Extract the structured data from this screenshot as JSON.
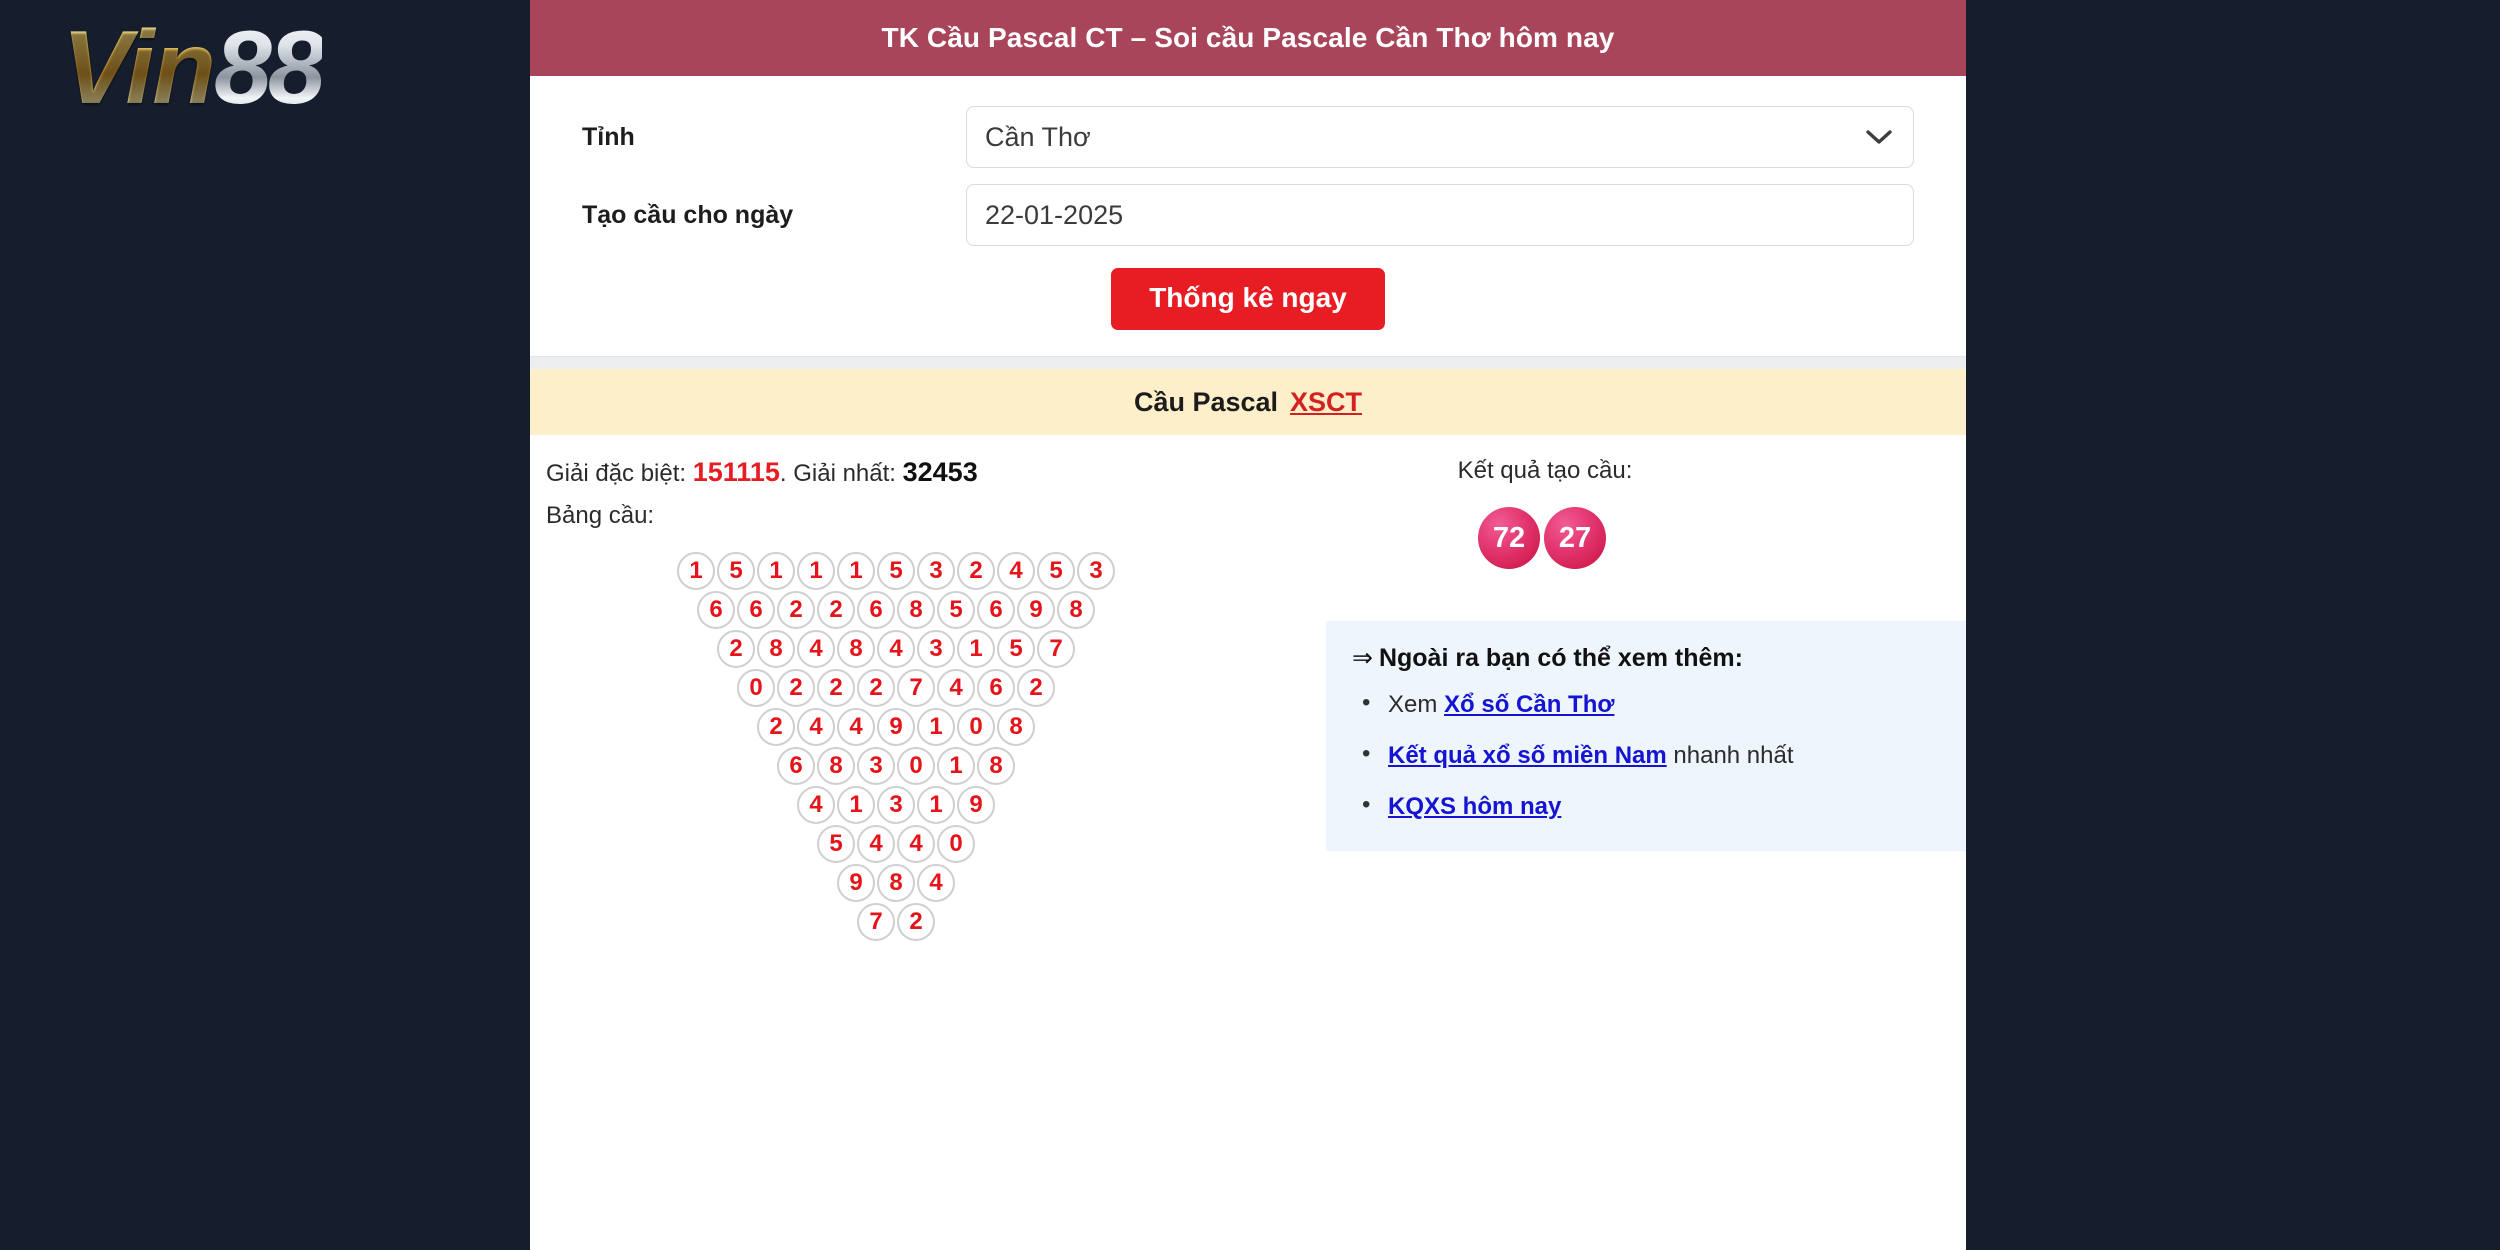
{
  "brand": {
    "name_gold": "Vin",
    "name_silver": "88"
  },
  "panel": {
    "header_title": "TK Cầu Pascal CT – Soi cầu Pascale Cần Thơ hôm nay",
    "header_bg": "#a9455a"
  },
  "form": {
    "province_label": "Tỉnh",
    "province_value": "Cần Thơ",
    "province_options": [
      "Cần Thơ"
    ],
    "date_label": "Tạo cầu cho ngày",
    "date_value": "22-01-2025",
    "date_placeholder": "22-01-2025",
    "submit_label": "Thống kê ngay",
    "submit_color": "#e81c23",
    "chevron_icon": "chevron-down-icon"
  },
  "subheader": {
    "text": "Cầu Pascal",
    "link_label": "XSCT",
    "bg": "#fcefc9",
    "link_color": "#d42020"
  },
  "results": {
    "special_prize_label": "Giải đặc biệt:",
    "special_prize_value": "151115",
    "special_separator": ".",
    "first_prize_label": "Giải nhất:",
    "first_prize_value": "32453",
    "table_label": "Bảng cầu:",
    "ball_color": "#e4141a"
  },
  "chart_data": {
    "type": "table",
    "title": "Bảng cầu Pascal",
    "description": "Pascal triangle reduction: each row is formed by summing adjacent digits of the row above, modulo 10.",
    "rows": [
      [
        1,
        5,
        1,
        1,
        1,
        5,
        3,
        2,
        4,
        5,
        3
      ],
      [
        6,
        6,
        2,
        2,
        6,
        8,
        5,
        6,
        9,
        8
      ],
      [
        2,
        8,
        4,
        8,
        4,
        3,
        1,
        5,
        7
      ],
      [
        0,
        2,
        2,
        2,
        7,
        4,
        6,
        2
      ],
      [
        2,
        4,
        4,
        9,
        1,
        0,
        8
      ],
      [
        6,
        8,
        3,
        0,
        1,
        8
      ],
      [
        4,
        1,
        3,
        1,
        9
      ],
      [
        5,
        4,
        4,
        0
      ],
      [
        9,
        8,
        4
      ],
      [
        7,
        2
      ]
    ]
  },
  "output": {
    "title": "Kết quả tạo cầu:",
    "balls": [
      "72",
      "27"
    ],
    "ball_bg": "#c8103f"
  },
  "info": {
    "arrow": "⇒",
    "title": "Ngoài ra bạn có thể xem thêm:",
    "bg": "#eef5fc",
    "items": [
      {
        "prefix": "Xem ",
        "link": "Xổ số Cần Thơ",
        "suffix": ""
      },
      {
        "prefix": "",
        "link": "Kết quả xổ số miền Nam",
        "suffix": " nhanh nhất"
      },
      {
        "prefix": "",
        "link": "KQXS hôm nay",
        "suffix": ""
      }
    ],
    "link_color": "#1414d2"
  },
  "theme": {
    "page_bg": "#161e2e",
    "panel_bg": "#ffffff"
  }
}
